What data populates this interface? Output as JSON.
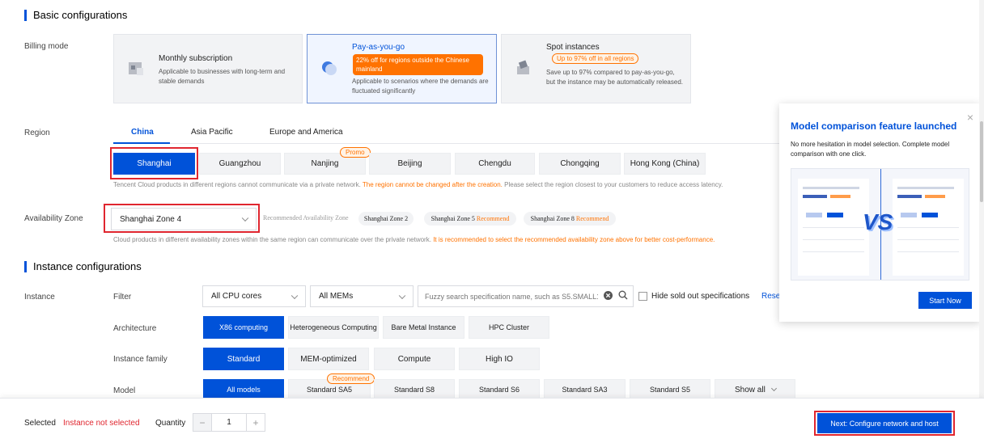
{
  "basic": {
    "title": "Basic configurations",
    "billing_label": "Billing mode",
    "billing_cards": [
      {
        "title": "Monthly subscription",
        "desc": "Applicable to businesses with long-term and stable demands",
        "icon": "calendar-icon"
      },
      {
        "title": "Pay-as-you-go",
        "badge": "22% off for regions outside the Chinese mainland",
        "desc": "Applicable to scenarios where the demands are fluctuated significantly",
        "icon": "pie-chart-icon"
      },
      {
        "title": "Spot instances",
        "badge": "Up to 97% off in all regions",
        "desc": "Save up to 97% compared to pay-as-you-go, but the instance may be automatically released.",
        "icon": "tag-icon"
      }
    ],
    "region_label": "Region",
    "region_tabs": [
      "China",
      "Asia Pacific",
      "Europe and America"
    ],
    "cities": [
      "Shanghai",
      "Guangzhou",
      "Nanjing",
      "Beijing",
      "Chengdu",
      "Chongqing",
      "Hong Kong (China)"
    ],
    "promo": "Promo",
    "region_hint": "Tencent Cloud products in different regions cannot communicate via a private network.",
    "region_hint_warn": "The region cannot be changed after the creation.",
    "region_hint_tail": "Please select the region closest to your customers to reduce access latency.",
    "az_label": "Availability Zone",
    "az_selected": "Shanghai Zone 4",
    "az_recommended_label": "Recommended Availability Zone",
    "az_tags": [
      {
        "name": "Shanghai Zone 2",
        "rec": ""
      },
      {
        "name": "Shanghai Zone 5",
        "rec": "Recommend"
      },
      {
        "name": "Shanghai Zone 8",
        "rec": "Recommend"
      }
    ],
    "az_hint": "Cloud products in different availability zones within the same region can communicate over the private network.",
    "az_hint_warn": "It is recommended to select the recommended availability zone above for better cost-performance."
  },
  "instance": {
    "title": "Instance configurations",
    "instance_label": "Instance",
    "filter_label": "Filter",
    "cpu_select": "All CPU cores",
    "mem_select": "All MEMs",
    "search_placeholder": "Fuzzy search specification name, such as S5.SMALL1",
    "hide_sold_out": "Hide sold out specifications",
    "reset": "Rese",
    "architecture_label": "Architecture",
    "architectures": [
      "X86 computing",
      "Heterogeneous Computing",
      "Bare Metal Instance",
      "HPC Cluster"
    ],
    "family_label": "Instance family",
    "families": [
      "Standard",
      "MEM-optimized",
      "Compute",
      "High IO"
    ],
    "model_label": "Model",
    "models": [
      "All models",
      "Standard SA5",
      "Standard S8",
      "Standard S6",
      "Standard SA3",
      "Standard S5",
      "Show all"
    ],
    "recommend": "Recommend"
  },
  "footer": {
    "selected_label": "Selected",
    "selected_value": "Instance not selected",
    "quantity_label": "Quantity",
    "quantity": "1",
    "minus": "−",
    "plus": "+",
    "next": "Next: Configure network and host"
  },
  "popup": {
    "title": "Model comparison feature launched",
    "body": "No more hesitation in model selection. Complete model comparison with one click.",
    "vs": "VS",
    "start": "Start Now",
    "close": "×"
  },
  "colors": {
    "primary": "#0052d9",
    "orange": "#ff7200",
    "red": "#e0262f"
  }
}
